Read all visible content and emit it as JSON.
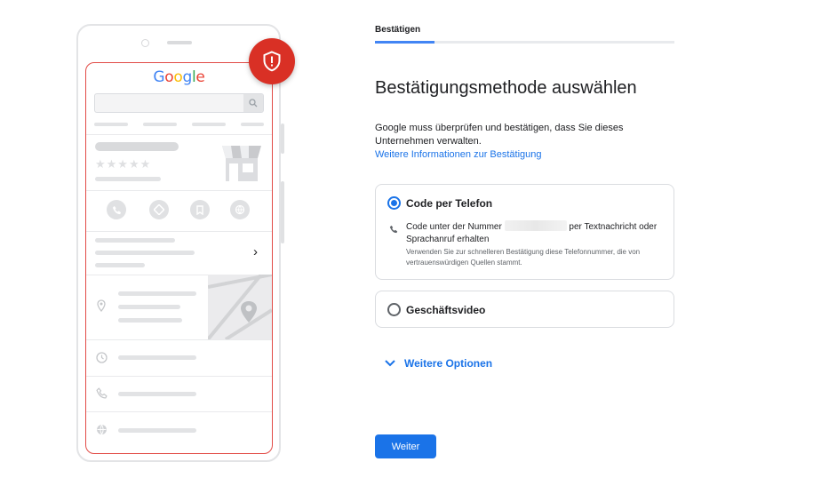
{
  "illustration": {
    "google_logo": [
      {
        "ch": "G",
        "color": "#4285f4"
      },
      {
        "ch": "o",
        "color": "#ea4335"
      },
      {
        "ch": "o",
        "color": "#fbbc05"
      },
      {
        "ch": "g",
        "color": "#4285f4"
      },
      {
        "ch": "l",
        "color": "#34a853"
      },
      {
        "ch": "e",
        "color": "#ea4335"
      }
    ],
    "stars": "★★★★★"
  },
  "progress": {
    "step_label": "Bestätigen",
    "fill_fraction": 0.2
  },
  "main": {
    "heading": "Bestätigungsmethode auswählen",
    "description": "Google muss überprüfen und bestätigen, dass Sie dieses Unternehmen verwalten.",
    "more_info_link": "Weitere Informationen zur Bestätigung",
    "options": [
      {
        "label": "Code per Telefon",
        "selected": true,
        "detail_before": "Code unter der Nummer",
        "detail_after": "per Textnachricht oder Sprachanruf erhalten",
        "note": "Verwenden Sie zur schnelleren Bestätigung diese Telefonnummer, die von vertrauenswürdigen Quellen stammt."
      },
      {
        "label": "Geschäftsvideo",
        "selected": false
      }
    ],
    "more_options": "Weitere Optionen",
    "next_button": "Weiter"
  },
  "colors": {
    "accent": "#1a73e8",
    "progress": "#4285f4",
    "alert": "#d93025"
  }
}
